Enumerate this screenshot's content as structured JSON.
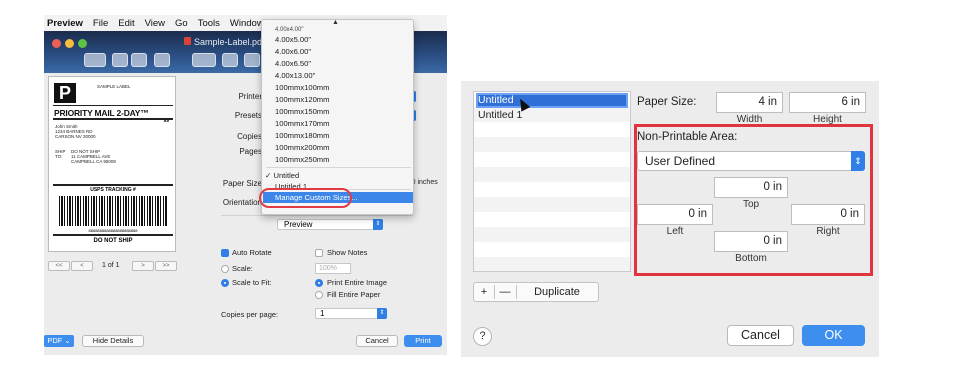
{
  "menubar": {
    "app": "Preview",
    "items": [
      "File",
      "Edit",
      "View",
      "Go",
      "Tools",
      "Window"
    ]
  },
  "window": {
    "title": "Sample-Label.pdf ("
  },
  "label_preview": {
    "logo_letter": "P",
    "service": "PRIORITY MAIL 2-DAY™",
    "service_code": "99",
    "from_lines": [
      "John Smith",
      "1234 BARNES RD",
      "CARSON NV 30000"
    ],
    "ship_to_prefix": "SHIP\nTO:",
    "ship_to_lines": [
      "DO NOT SHIP",
      "11 CAMPBELL AVE",
      "CAMPBELL CA 95008"
    ],
    "tracking_header": "USPS TRACKING #",
    "tracking_number": "8888888888888888888888",
    "footer": "DO NOT SHIP"
  },
  "pager": {
    "first": "<<",
    "prev": "<",
    "page": "1 of 1",
    "next": ">",
    "last": ">>"
  },
  "print_dialog": {
    "labels": {
      "printer": "Printer",
      "presets": "Presets",
      "copies": "Copies",
      "pages": "Pages",
      "paper_size": "Paper Size",
      "orientation": "Orientation",
      "copies_per_page": "Copies per page:"
    },
    "paper_size_note": "4.00 by 6.00 inches",
    "preview_select": "Preview",
    "auto_rotate": "Auto Rotate",
    "show_notes": "Show Notes",
    "scale_label": "Scale:",
    "scale_value": "100%",
    "scale_to_fit": "Scale to Fit:",
    "print_entire_image": "Print Entire Image",
    "fill_entire_paper": "Fill Entire Paper",
    "copies_per_page_value": "1",
    "pdf_button": "PDF",
    "hide_details": "Hide Details",
    "cancel": "Cancel",
    "print": "Print"
  },
  "paper_dropdown": {
    "sizes": [
      "4.00x4.00\"",
      "4.00x5.00\"",
      "4.00x6.00\"",
      "4.00x6.50\"",
      "4.00x13.00\"",
      "100mmx100mm",
      "100mmx120mm",
      "100mmx150mm",
      "100mmx170mm",
      "100mmx180mm",
      "100mmx200mm",
      "100mmx250mm"
    ],
    "custom_selected": "✓ Untitled",
    "custom_other": "Untitled 1",
    "manage": "Manage Custom Sizes..."
  },
  "custom_sizes": {
    "list_items": [
      "Untitled",
      "Untitled 1"
    ],
    "add": "+",
    "remove": "—",
    "duplicate": "Duplicate",
    "paper_size_label": "Paper Size:",
    "width_value": "4 in",
    "height_value": "6 in",
    "width_label": "Width",
    "height_label": "Height",
    "non_printable_label": "Non-Printable Area:",
    "non_printable_select": "User Defined",
    "top_value": "0 in",
    "top_label": "Top",
    "left_value": "0 in",
    "left_label": "Left",
    "right_value": "0 in",
    "right_label": "Right",
    "bottom_value": "0 in",
    "bottom_label": "Bottom",
    "help": "?",
    "cancel": "Cancel",
    "ok": "OK"
  },
  "colors": {
    "accent": "#2f7fe6",
    "highlight_ring": "#e0343f",
    "selection": "#2f6fd6"
  }
}
